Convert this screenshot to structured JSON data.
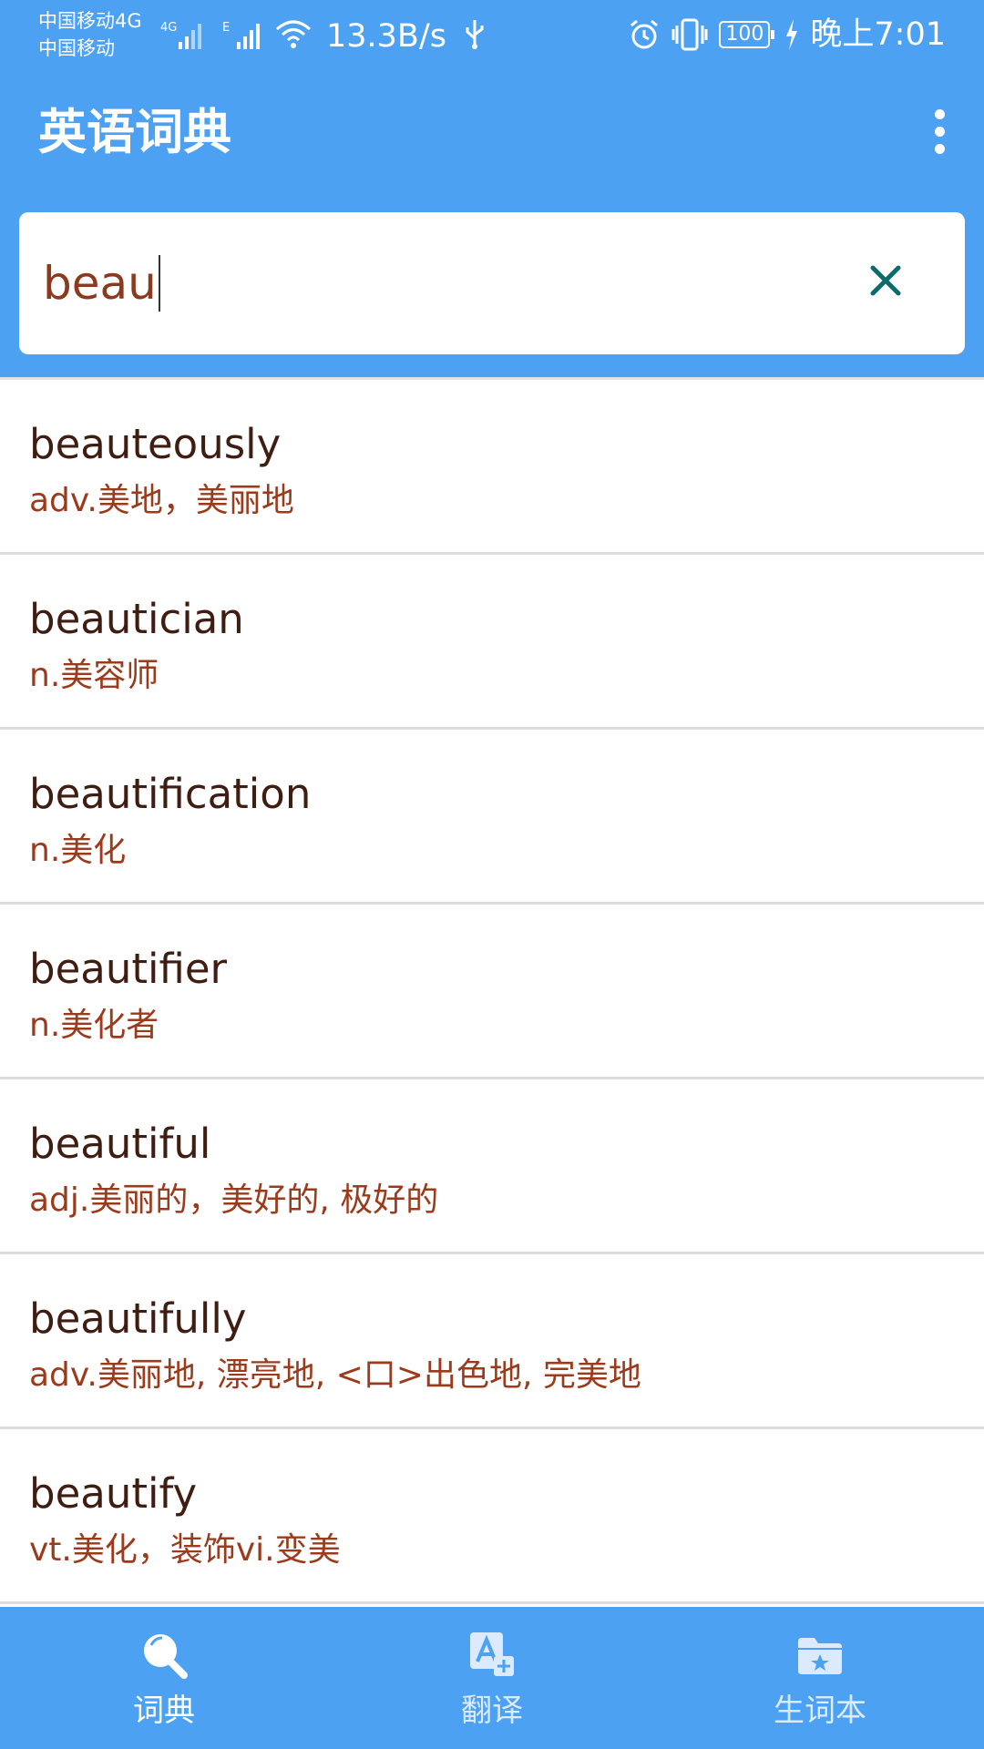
{
  "status_bar": {
    "carrier1": "中国移动4G",
    "carrier2": "中国移动",
    "sig1_label": "4G",
    "sig2_label": "E",
    "net_speed": "13.3B/s",
    "battery": "100",
    "time": "晚上7:01"
  },
  "app_bar": {
    "title": "英语词典"
  },
  "search": {
    "value": "beau"
  },
  "results": [
    {
      "word": "beauteously",
      "meaning": "adv.美地，美丽地"
    },
    {
      "word": "beautician",
      "meaning": "n.美容师"
    },
    {
      "word": "beautification",
      "meaning": "n.美化"
    },
    {
      "word": "beautifier",
      "meaning": "n.美化者"
    },
    {
      "word": "beautiful",
      "meaning": "adj.美丽的，美好的, 极好的"
    },
    {
      "word": "beautifully",
      "meaning": "adv.美丽地, 漂亮地, <口>出色地, 完美地"
    },
    {
      "word": "beautify",
      "meaning": "vt.美化，装饰vi.变美"
    }
  ],
  "bottom_nav": [
    {
      "label": "词典",
      "icon": "search-icon",
      "active": true
    },
    {
      "label": "翻译",
      "icon": "translate-icon",
      "active": false
    },
    {
      "label": "生词本",
      "icon": "vocab-folder-icon",
      "active": false
    }
  ],
  "colors": {
    "primary": "#4da1f2",
    "word_text": "#3f1d13",
    "meaning_text": "#9b3b1c",
    "clear_icon": "#0e6b6b"
  }
}
